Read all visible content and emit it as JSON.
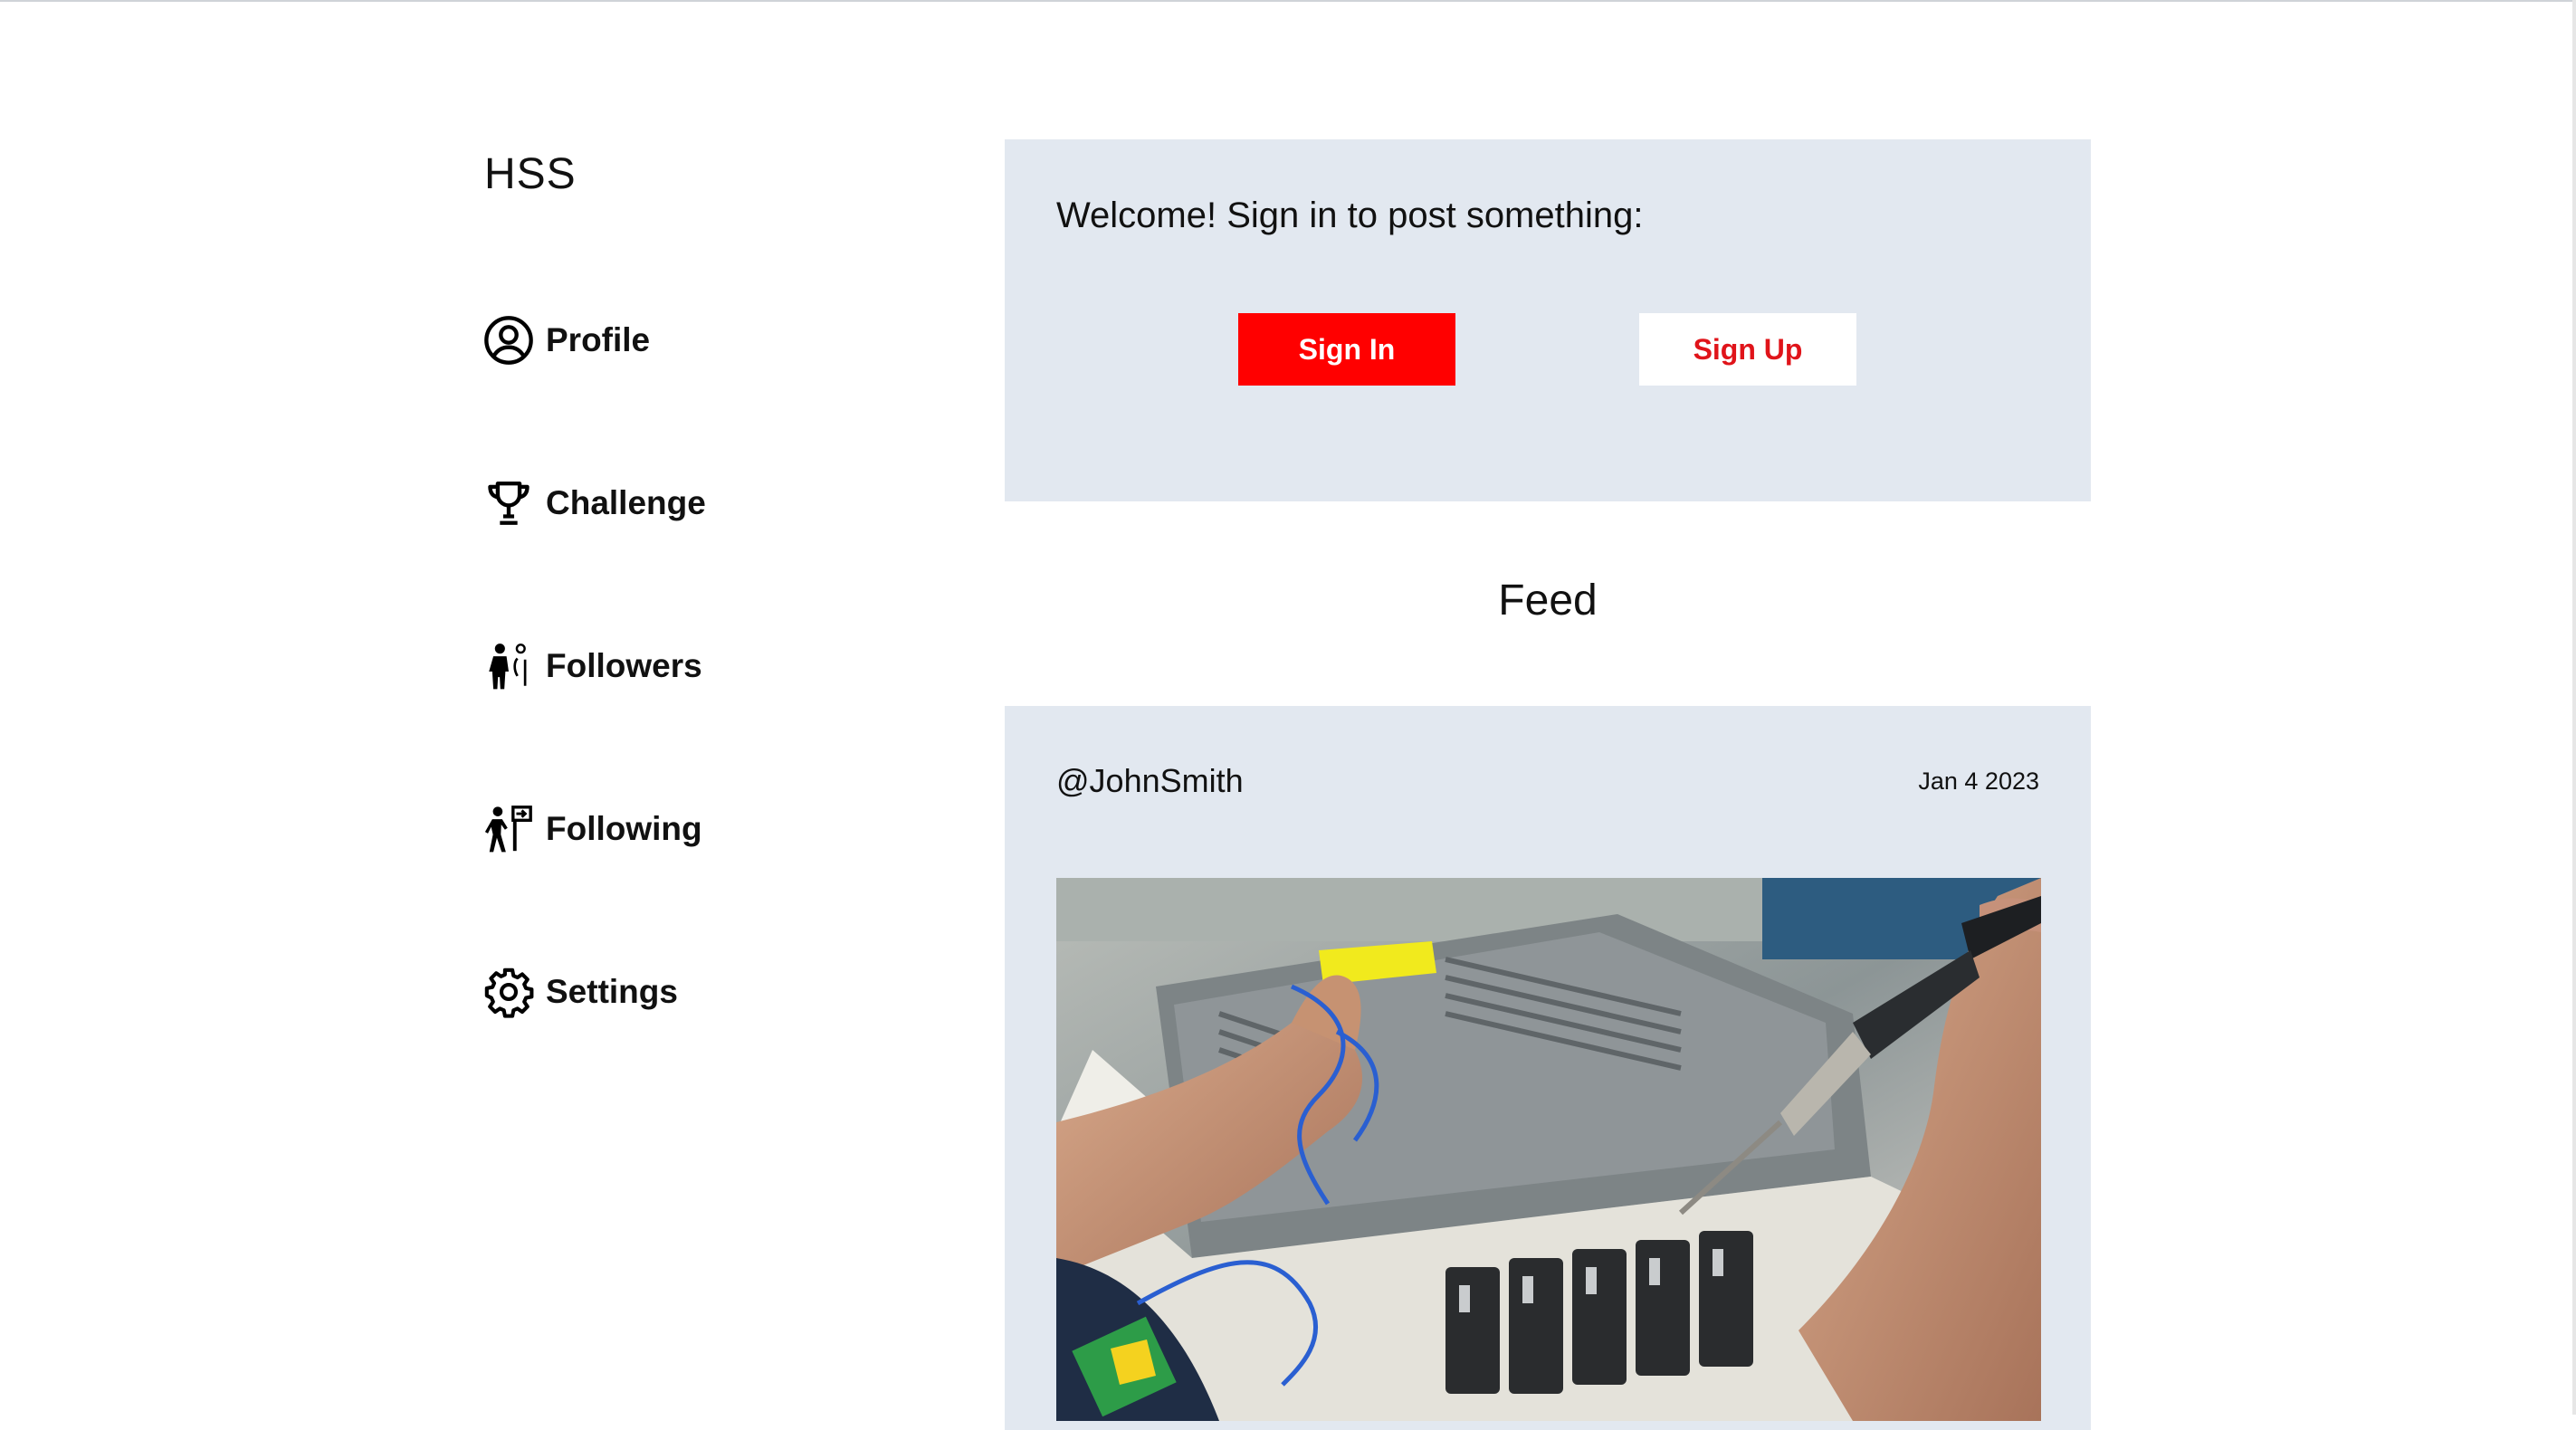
{
  "app": {
    "brand": "HSS"
  },
  "sidebar": {
    "items": [
      {
        "label": "Profile",
        "icon": "user-circle-icon"
      },
      {
        "label": "Challenge",
        "icon": "trophy-icon"
      },
      {
        "label": "Followers",
        "icon": "followers-icon"
      },
      {
        "label": "Following",
        "icon": "following-icon"
      },
      {
        "label": "Settings",
        "icon": "gear-icon"
      }
    ]
  },
  "signin": {
    "message": "Welcome! Sign in to post something:",
    "sign_in_label": "Sign In",
    "sign_up_label": "Sign Up"
  },
  "feed": {
    "title": "Feed",
    "posts": [
      {
        "user": "@JohnSmith",
        "date": "Jan 4 2023",
        "image": "photo of hands soldering blue wires onto electronic connectors"
      }
    ]
  },
  "colors": {
    "panel_bg": "#e2e8f0",
    "primary": "#ff0000",
    "text": "#111111"
  }
}
